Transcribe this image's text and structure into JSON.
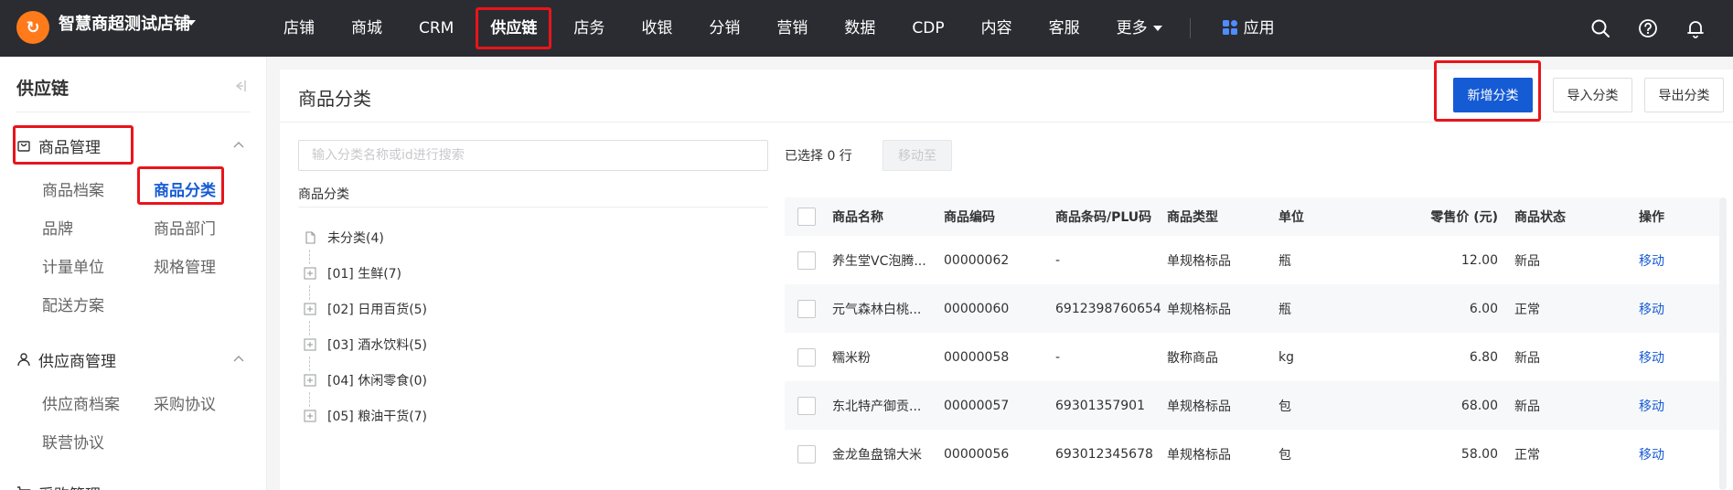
{
  "header": {
    "store_name": "智慧商超测试店铺",
    "logo_glyph": "↻",
    "nav": [
      {
        "label": "店铺"
      },
      {
        "label": "商城"
      },
      {
        "label": "CRM"
      },
      {
        "label": "供应链",
        "active": true
      },
      {
        "label": "店务"
      },
      {
        "label": "收银"
      },
      {
        "label": "分销"
      },
      {
        "label": "营销"
      },
      {
        "label": "数据"
      },
      {
        "label": "CDP"
      },
      {
        "label": "内容"
      },
      {
        "label": "客服"
      },
      {
        "label": "更多"
      }
    ],
    "apps_label": "应用",
    "icons": [
      "search-icon",
      "help-icon",
      "bell-icon"
    ],
    "accent": "#ff7a1a",
    "bg": "#2b2c31",
    "highlight": "#e8151b"
  },
  "sidebar": {
    "title": "供应链",
    "groups": [
      {
        "label": "商品管理",
        "icon": "bag-icon",
        "items": [
          "商品档案",
          "商品分类",
          "品牌",
          "商品部门",
          "计量单位",
          "规格管理",
          "配送方案"
        ],
        "current": "商品分类"
      },
      {
        "label": "供应商管理",
        "icon": "user-icon",
        "items": [
          "供应商档案",
          "采购协议",
          "联营协议"
        ]
      },
      {
        "label": "采购管理",
        "icon": "cart-icon"
      }
    ]
  },
  "main": {
    "title": "商品分类",
    "buttons": {
      "add": "新增分类",
      "import": "导入分类",
      "export": "导出分类"
    },
    "search_placeholder": "输入分类名称或id进行搜索",
    "tree_label": "商品分类",
    "tree": [
      {
        "label": "未分类(4)",
        "icon": "file-icon"
      },
      {
        "label": "[01] 生鲜(7)",
        "icon": "plus-square-icon"
      },
      {
        "label": "[02] 日用百货(5)",
        "icon": "plus-square-icon"
      },
      {
        "label": "[03] 酒水饮料(5)",
        "icon": "plus-square-icon"
      },
      {
        "label": "[04] 休闲零食(0)",
        "icon": "plus-square-icon"
      },
      {
        "label": "[05] 粮油干货(7)",
        "icon": "plus-square-icon"
      }
    ],
    "selected_count": "已选择 0 行",
    "move_to": "移动至",
    "table": {
      "columns": [
        "商品名称",
        "商品编码",
        "商品条码/PLU码",
        "商品类型",
        "单位",
        "零售价 (元)",
        "商品状态",
        "操作"
      ],
      "rows": [
        {
          "name": "养生堂VC泡腾...",
          "code": "00000062",
          "barcode": "-",
          "type": "单规格标品",
          "unit": "瓶",
          "price": "12.00",
          "status": "新品",
          "op": "移动"
        },
        {
          "name": "元气森林白桃...",
          "code": "00000060",
          "barcode": "6912398760654",
          "type": "单规格标品",
          "unit": "瓶",
          "price": "6.00",
          "status": "正常",
          "op": "移动"
        },
        {
          "name": "糯米粉",
          "code": "00000058",
          "barcode": "-",
          "type": "散称商品",
          "unit": "kg",
          "price": "6.80",
          "status": "新品",
          "op": "移动"
        },
        {
          "name": "东北特产御贡...",
          "code": "00000057",
          "barcode": "69301357901",
          "type": "单规格标品",
          "unit": "包",
          "price": "68.00",
          "status": "新品",
          "op": "移动"
        },
        {
          "name": "金龙鱼盘锦大米",
          "code": "00000056",
          "barcode": "693012345678",
          "type": "单规格标品",
          "unit": "包",
          "price": "58.00",
          "status": "正常",
          "op": "移动"
        }
      ]
    }
  }
}
